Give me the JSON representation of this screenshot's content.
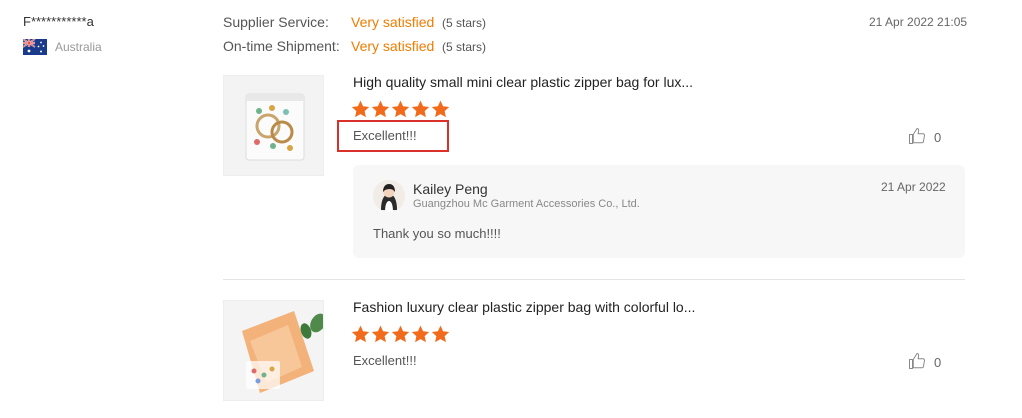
{
  "reviewer": {
    "name": "F***********a",
    "country": "Australia",
    "flag_icon": "australia-flag-icon"
  },
  "ratings": [
    {
      "label": "Supplier Service:",
      "value": "Very satisfied",
      "note": "(5 stars)",
      "stars": 5
    },
    {
      "label": "On-time Shipment:",
      "value": "Very satisfied",
      "note": "(5 stars)",
      "stars": 5
    }
  ],
  "date": "21 Apr 2022 21:05",
  "colors": {
    "accent": "#f07c00",
    "star": "#f26a1b",
    "highlight": "#d9302c",
    "reply_bg": "#f7f7f7"
  },
  "products": [
    {
      "title": "High quality small mini clear plastic zipper bag for lux...",
      "stars": 5,
      "review": "Excellent!!!",
      "likes": "0",
      "reply": {
        "name": "Kailey Peng",
        "company": "Guangzhou Mc Garment Accessories Co., Ltd.",
        "date": "21 Apr 2022",
        "text": "Thank you so much!!!!"
      }
    },
    {
      "title": "Fashion luxury clear plastic zipper bag with colorful lo...",
      "stars": 5,
      "review": "Excellent!!!",
      "likes": "0"
    }
  ]
}
